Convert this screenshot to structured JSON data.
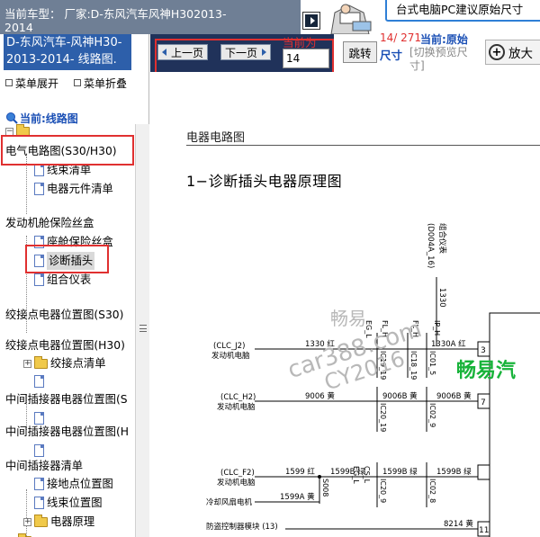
{
  "header": {
    "car_title_line1": "当前车型：  厂家:D-东风汽车风神H302013-",
    "car_title_line2": "2014",
    "tip_text": "台式电脑PC建议原始尺寸"
  },
  "left_panel": {
    "title_line1": "D-东风汽车-风神H30-",
    "title_line2": "2013-2014- 线路图.",
    "expand_menu": "菜单展开",
    "collapse_menu": "菜单折叠",
    "current_label": "当前:线路图",
    "tree": [
      {
        "label": "电气电路图(S30/H30)"
      },
      {
        "label": "线束清单"
      },
      {
        "label": "电器元件清单"
      },
      {
        "label": "发动机舱保险丝盒"
      },
      {
        "label": "座舱保险丝盒"
      },
      {
        "label": "诊断插头"
      },
      {
        "label": "组合仪表"
      },
      {
        "label": "绞接点电器位置图(S30)"
      },
      {
        "label": "绞接点电器位置图(H30)"
      },
      {
        "label": "绞接点清单"
      },
      {
        "label": "中间插接器电器位置图(S"
      },
      {
        "label": "中间插接器电器位置图(H"
      },
      {
        "label": "中间插接器清单"
      },
      {
        "label": "接地点位置图"
      },
      {
        "label": "线束位置图"
      },
      {
        "label": "电器原理"
      }
    ]
  },
  "toolbar": {
    "prev_page": "上一页",
    "next_page": "下一页",
    "current_page_label": "当前为",
    "page_value": "14",
    "jump": "跳转",
    "page_count": "14/ 271",
    "current_label": "当前:",
    "original_label": "原始",
    "size_label": "尺寸",
    "switch_preview": "[切换预览尺寸]",
    "zoom": "放大"
  },
  "document": {
    "section_title": "电器电路图",
    "heading": "1−诊断插头电器原理图",
    "watermarks": {
      "brand_cn": "畅易",
      "site": "car388.com",
      "copyright": "CY2016",
      "logo": "畅易汽"
    },
    "labels": {
      "combo_meter": "组合仪表",
      "combo_code": "(D004A_16)",
      "wire_1330": "1330",
      "clc_j2": "(CLC_J2)",
      "ecu1": "发动机电脑",
      "clc_h2": "(CLC_H2)",
      "ecu2": "发动机电脑",
      "clc_f2": "(CLC_F2)",
      "ecu3": "发动机电脑",
      "fan": "冷却风扇电机",
      "antitheft": "防盗控制器模块 (13)",
      "w1330_red": "1330   红",
      "w1330a_red": "1330A  红",
      "w9006_yel": "9006   黄",
      "w9006b_yel": "9006B  黄",
      "w9006b_yel2": "9006B  黄",
      "w1599_red": "1599   红",
      "w1599b_grn": "1599B  绿",
      "w1599b_grn2": "1599B  绿",
      "w1599b_grn3": "1599B  绿",
      "w1599a_yel": "1599A  黄",
      "w8214_yel": "8214  黄",
      "eg_l": "EG_L",
      "fl_h": "FL_H",
      "fl_h2": "FL_H",
      "ip_h": "IP_H",
      "ic19_19": "IC19_19",
      "ic18_19": "IC18_19",
      "ic01_5": "IC01_5",
      "ic20_19": "IC20_19",
      "ic02_9": "IC02_9",
      "ic20_9": "IC20_9",
      "ic02_8": "IC02_8",
      "s008": "S008",
      "eg_l2": "EG_L",
      "cs_l": "CS_L",
      "pin3": "3",
      "pin7": "7",
      "pin11": "11"
    }
  }
}
